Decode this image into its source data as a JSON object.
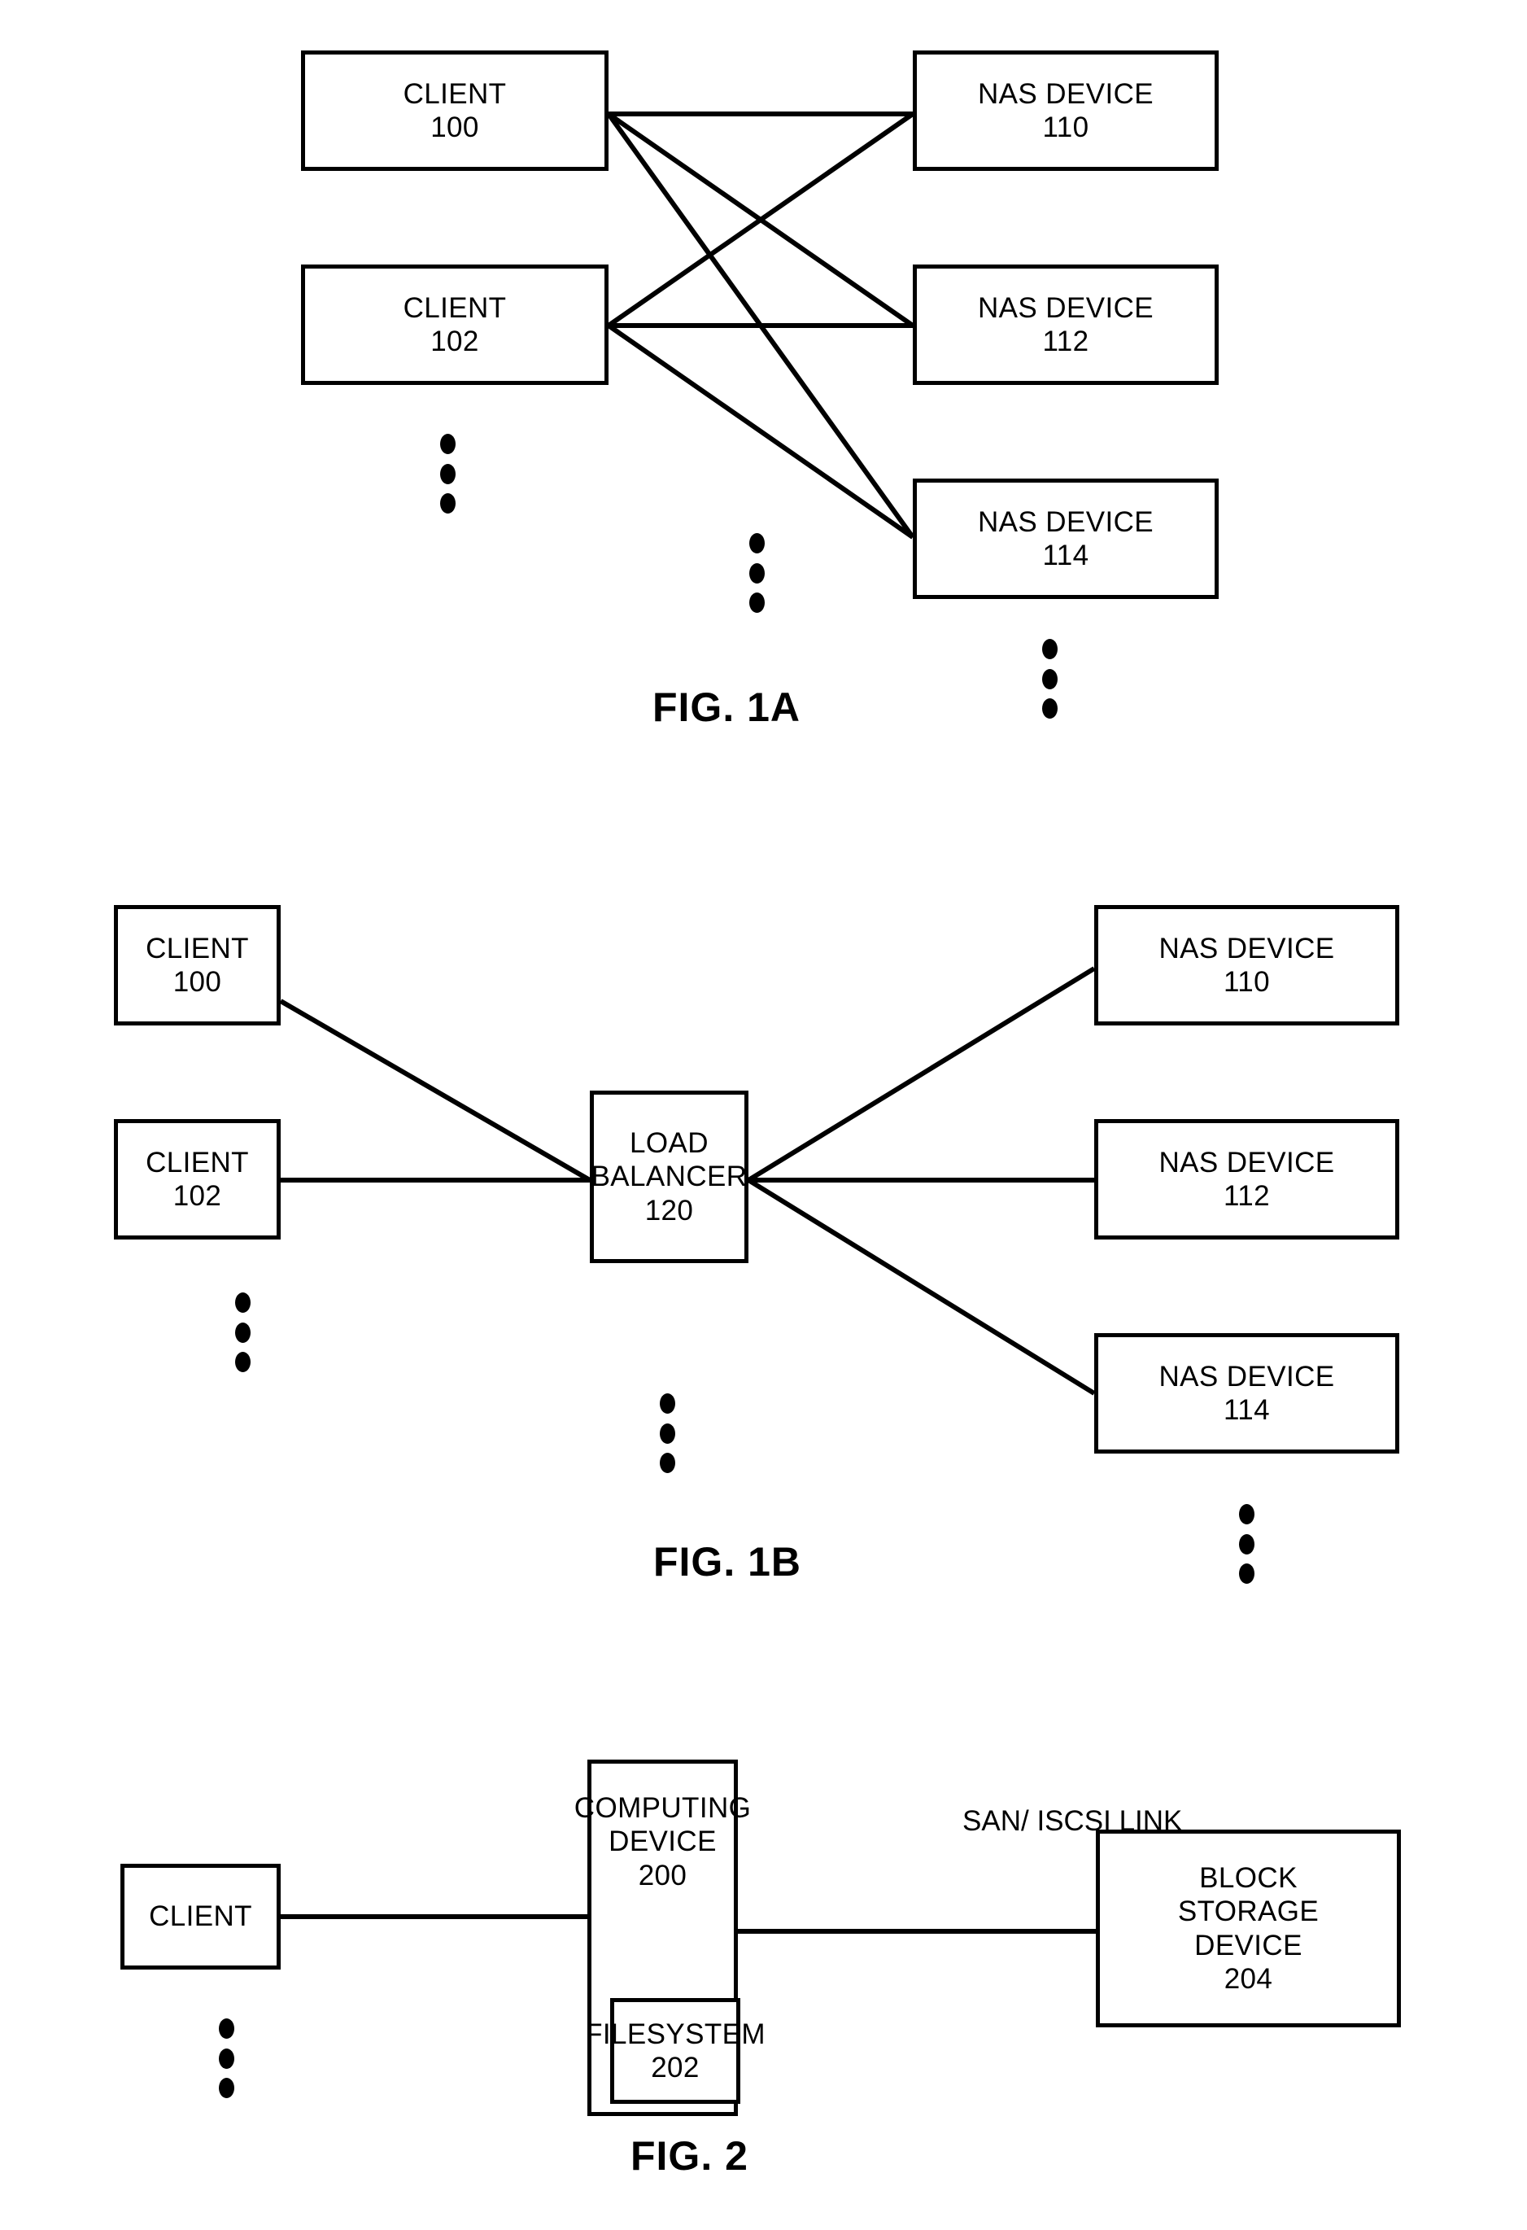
{
  "figures": [
    {
      "id": "fig-1a",
      "label": "FIG. 1A",
      "nodes": [
        {
          "key": "client100",
          "lines": [
            "CLIENT",
            "100"
          ]
        },
        {
          "key": "client102",
          "lines": [
            "CLIENT",
            "102"
          ]
        },
        {
          "key": "nas110",
          "lines": [
            "NAS DEVICE",
            "110"
          ]
        },
        {
          "key": "nas112",
          "lines": [
            "NAS DEVICE",
            "112"
          ]
        },
        {
          "key": "nas114",
          "lines": [
            "NAS DEVICE",
            "114"
          ]
        }
      ]
    },
    {
      "id": "fig-1b",
      "label": "FIG. 1B",
      "nodes": [
        {
          "key": "client100",
          "lines": [
            "CLIENT",
            "100"
          ]
        },
        {
          "key": "client102",
          "lines": [
            "CLIENT",
            "102"
          ]
        },
        {
          "key": "loadbalancer120",
          "lines": [
            "LOAD",
            "BALANCER",
            "120"
          ]
        },
        {
          "key": "nas110",
          "lines": [
            "NAS DEVICE",
            "110"
          ]
        },
        {
          "key": "nas112",
          "lines": [
            "NAS DEVICE",
            "112"
          ]
        },
        {
          "key": "nas114",
          "lines": [
            "NAS DEVICE",
            "114"
          ]
        }
      ]
    },
    {
      "id": "fig-2",
      "label": "FIG. 2",
      "nodes": [
        {
          "key": "client",
          "lines": [
            "CLIENT"
          ]
        },
        {
          "key": "computing200",
          "lines": [
            "COMPUTING",
            "DEVICE",
            "200"
          ]
        },
        {
          "key": "filesystem202",
          "lines": [
            "FILESYSTEM",
            "202"
          ]
        },
        {
          "key": "blockstorage204",
          "lines": [
            "BLOCK",
            "STORAGE",
            "DEVICE",
            "204"
          ]
        }
      ],
      "link_label": [
        "SAN/",
        "ISCSI",
        "LINK"
      ]
    }
  ],
  "fig1a": {
    "client100_l1": "CLIENT",
    "client100_l2": "100",
    "client102_l1": "CLIENT",
    "client102_l2": "102",
    "nas110_l1": "NAS DEVICE",
    "nas110_l2": "110",
    "nas112_l1": "NAS DEVICE",
    "nas112_l2": "112",
    "nas114_l1": "NAS DEVICE",
    "nas114_l2": "114",
    "label": "FIG. 1A"
  },
  "fig1b": {
    "client100_l1": "CLIENT",
    "client100_l2": "100",
    "client102_l1": "CLIENT",
    "client102_l2": "102",
    "lb_l1": "LOAD",
    "lb_l2": "BALANCER",
    "lb_l3": "120",
    "nas110_l1": "NAS DEVICE",
    "nas110_l2": "110",
    "nas112_l1": "NAS DEVICE",
    "nas112_l2": "112",
    "nas114_l1": "NAS DEVICE",
    "nas114_l2": "114",
    "label": "FIG. 1B"
  },
  "fig2": {
    "client_l1": "CLIENT",
    "computing_l1": "COMPUTING",
    "computing_l2": "DEVICE",
    "computing_l3": "200",
    "filesystem_l1": "FILESYSTEM",
    "filesystem_l2": "202",
    "link_l1": "SAN/",
    "link_l2": "ISCSI",
    "link_l3": "LINK",
    "block_l1": "BLOCK",
    "block_l2": "STORAGE",
    "block_l3": "DEVICE",
    "block_l4": "204",
    "label": "FIG. 2"
  },
  "colors": {
    "stroke": "#000000",
    "background": "#ffffff"
  }
}
